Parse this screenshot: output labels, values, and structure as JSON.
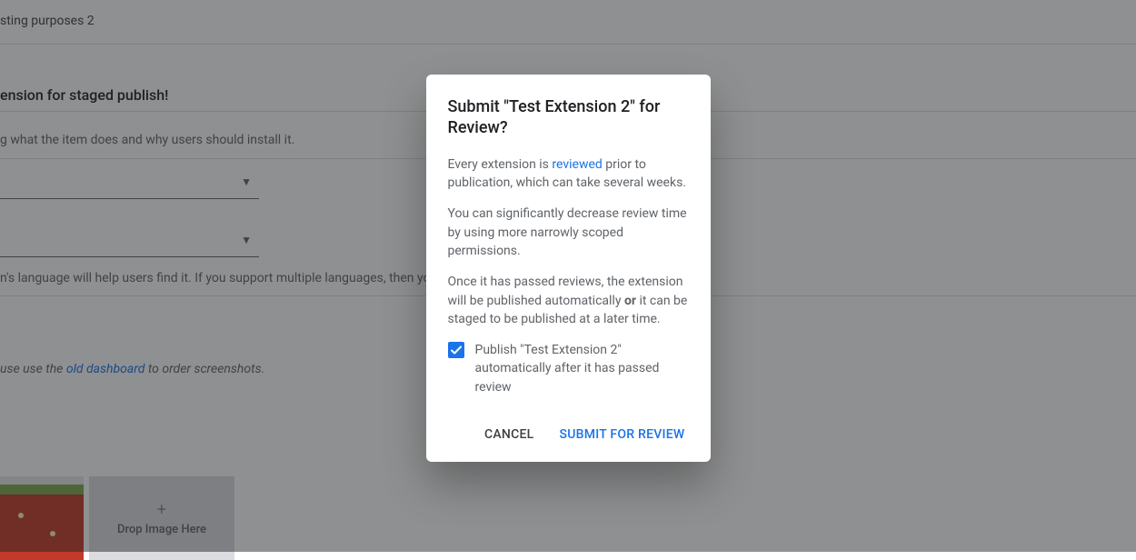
{
  "background": {
    "text1": "sting purposes 2",
    "heading": "ension for staged publish!",
    "helper1": "g what the item does and why users should install it.",
    "langHelper": "n's language will help users find it. If you support multiple languages, then you sh",
    "screenshotNotePrefix": "use use the ",
    "screenshotNoteLink": "old dashboard",
    "screenshotNoteSuffix": " to order screenshots.",
    "dropImage": "Drop Image Here"
  },
  "dialog": {
    "title": "Submit \"Test Extension 2\" for Review?",
    "p1a": "Every extension is ",
    "p1link": "reviewed",
    "p1b": " prior to publication, which can take several weeks.",
    "p2": "You can significantly decrease review time by using more narrowly scoped permissions.",
    "p3a": "Once it has passed reviews, the extension will be published automatically ",
    "p3bold": "or",
    "p3b": " it can be staged to be published at a later time.",
    "checkboxLabel": "Publish \"Test Extension 2\" automatically after it has passed review",
    "cancel": "CANCEL",
    "submit": "SUBMIT FOR REVIEW"
  }
}
